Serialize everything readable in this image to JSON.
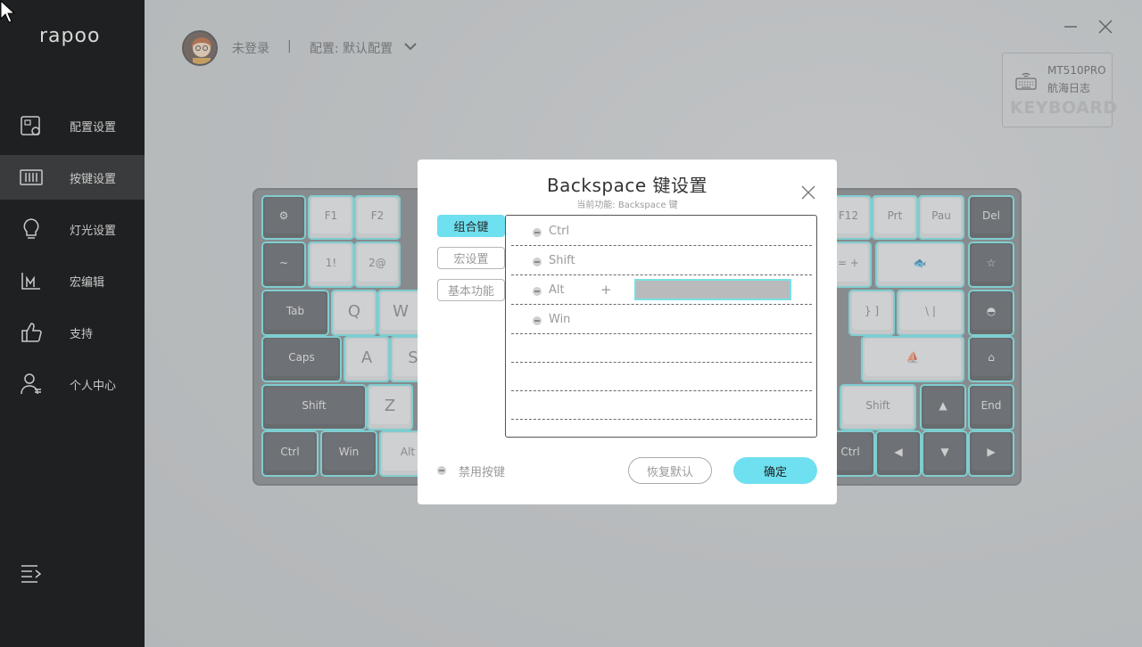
{
  "brand": {
    "logo": "rapoo"
  },
  "sidebar": {
    "items": [
      {
        "label": "配置设置",
        "icon": "config-icon",
        "active": false
      },
      {
        "label": "按键设置",
        "icon": "keys-icon",
        "active": true
      },
      {
        "label": "灯光设置",
        "icon": "bulb-icon",
        "active": false
      },
      {
        "label": "宏编辑",
        "icon": "macro-icon",
        "active": false
      },
      {
        "label": "支持",
        "icon": "thumbs-up-icon",
        "active": false
      },
      {
        "label": "个人中心",
        "icon": "user-icon",
        "active": false
      }
    ],
    "menu_icon": "menu-icon"
  },
  "header": {
    "login_status": "未登录",
    "separator": "|",
    "profile_label": "配置: 默认配置"
  },
  "device": {
    "model": "MT510PRO",
    "edition": "航海日志",
    "type_label": "KEYBOARD"
  },
  "keyboard": {
    "row0": [
      "F1",
      "F2",
      "F12",
      "Prt",
      "Pau",
      "Del"
    ],
    "row1": [
      "~",
      "1!",
      "2@",
      "= +"
    ],
    "row2": [
      "Tab",
      "Q",
      "W",
      "} ]",
      "\\ |"
    ],
    "row3": [
      "Caps",
      "A",
      "S"
    ],
    "row4": [
      "Shift",
      "Z",
      "Shift",
      "End"
    ],
    "row5": [
      "Ctrl",
      "Win",
      "Alt",
      "Ctrl"
    ]
  },
  "dialog": {
    "title": "Backspace 键设置",
    "subtitle": "当前功能: Backspace 键",
    "tabs": [
      {
        "label": "组合键",
        "active": true
      },
      {
        "label": "宏设置",
        "active": false
      },
      {
        "label": "基本功能",
        "active": false
      }
    ],
    "modifiers": [
      "Ctrl",
      "Shift",
      "Alt",
      "Win"
    ],
    "plus": "+",
    "key_input_value": "",
    "disable_label": "禁用按键",
    "reset_label": "恢复默认",
    "ok_label": "确定"
  },
  "colors": {
    "accent": "#6ee0f0",
    "sidebar_bg": "#1f2021"
  }
}
